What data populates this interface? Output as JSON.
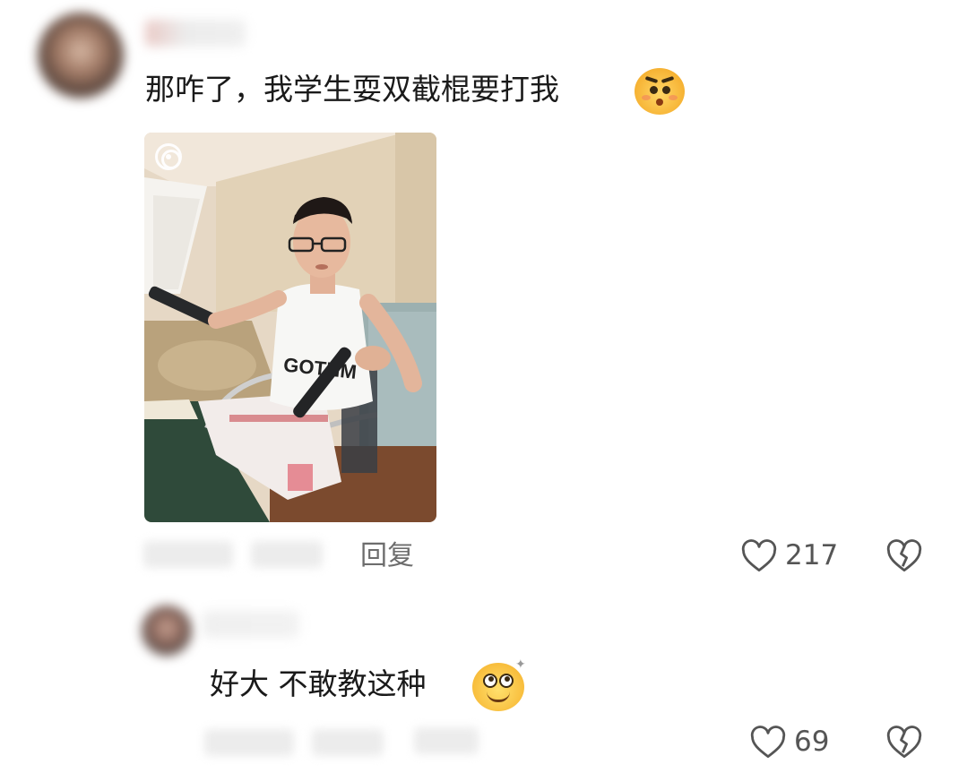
{
  "comments": [
    {
      "text": "那咋了，我学生耍双截棍要打我",
      "reply_label": "回复",
      "likes": "217",
      "emoji": "face-with-raised-brows-emoji"
    },
    {
      "text": "好大  不敢教这种",
      "likes": "69",
      "emoji": "googly-eyes-emoji"
    }
  ],
  "icons": {
    "like": "heart-outline-icon",
    "dislike": "broken-heart-icon",
    "photo_menu": "live-photo-icon"
  },
  "colors": {
    "text": "#1a1a1a",
    "meta": "#6d6d6d",
    "icon": "#555555",
    "background": "#ffffff"
  }
}
